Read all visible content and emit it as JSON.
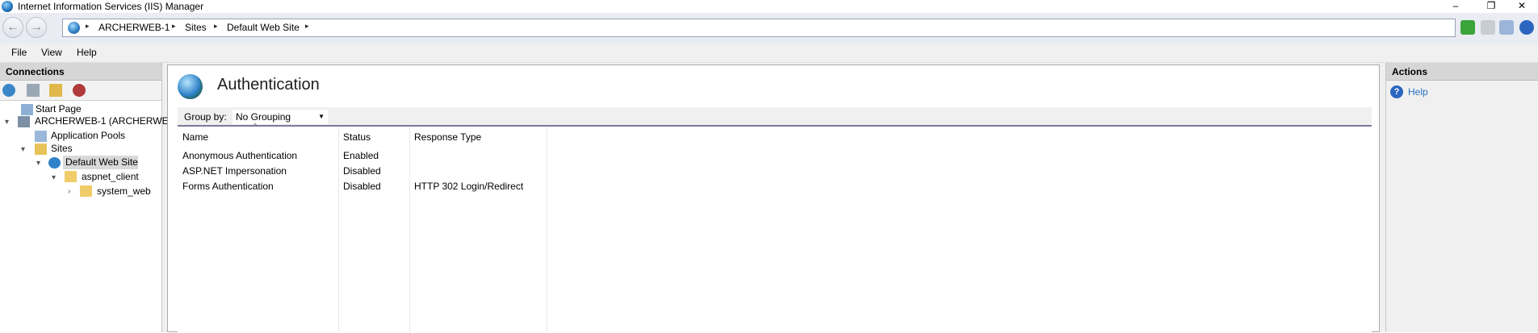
{
  "window": {
    "title": "Internet Information Services (IIS) Manager",
    "minimize_glyph": "–",
    "restore_glyph": "❐",
    "close_glyph": "✕"
  },
  "address_bar": {
    "breadcrumbs": [
      "ARCHERWEB-1",
      "Sites",
      "Default Web Site"
    ],
    "separator": "▸",
    "back_glyph": "←",
    "forward_glyph": "→"
  },
  "menu": {
    "items": [
      "File",
      "View",
      "Help"
    ]
  },
  "connections": {
    "header": "Connections",
    "tree": [
      {
        "label": "Start Page",
        "icon": "start-page-icon"
      },
      {
        "label": "ARCHERWEB-1 (ARCHERWEB",
        "icon": "server-icon",
        "expander": "▾"
      },
      {
        "label": "Application Pools",
        "icon": "app-pools-icon"
      },
      {
        "label": "Sites",
        "icon": "sites-icon",
        "expander": "▾"
      },
      {
        "label": "Default Web Site",
        "icon": "globe-icon",
        "expander": "▾"
      },
      {
        "label": "aspnet_client",
        "icon": "folder-icon",
        "expander": "▾"
      },
      {
        "label": "system_web",
        "icon": "folder-icon",
        "expander": "›"
      }
    ]
  },
  "main": {
    "title": "Authentication",
    "group_by_label": "Group by:",
    "group_by_value": "No Grouping",
    "sort_glyph": "^",
    "columns": [
      "Name",
      "Status",
      "Response Type"
    ],
    "rows": [
      {
        "name": "Anonymous Authentication",
        "status": "Enabled",
        "response_type": ""
      },
      {
        "name": "ASP.NET Impersonation",
        "status": "Disabled",
        "response_type": ""
      },
      {
        "name": "Forms Authentication",
        "status": "Disabled",
        "response_type": "HTTP 302 Login/Redirect"
      }
    ]
  },
  "actions": {
    "header": "Actions",
    "help_label": "Help",
    "help_glyph": "?"
  },
  "colors": {
    "link": "#2a6ebf",
    "pane_header": "#d6d6d6",
    "selection": "#d9d9d9"
  }
}
